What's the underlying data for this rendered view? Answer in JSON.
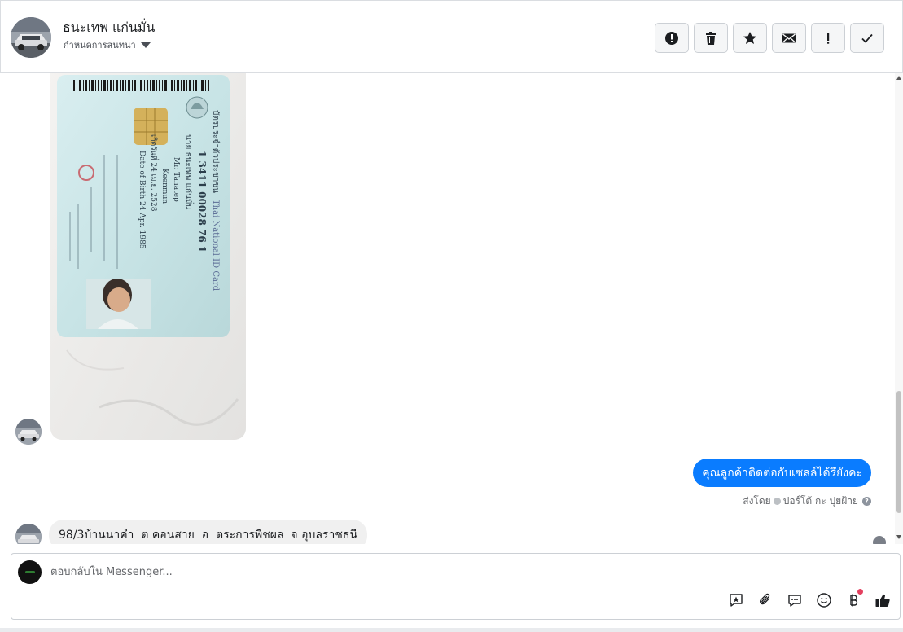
{
  "header": {
    "contact_name": "ธนะเทพ แก่นมั่น",
    "assign_label": "กำหนดการสนทนา",
    "toolbar": [
      {
        "name": "mark-spam-button",
        "icon": "alert-circle-icon"
      },
      {
        "name": "delete-button",
        "icon": "trash-icon"
      },
      {
        "name": "star-button",
        "icon": "star-icon"
      },
      {
        "name": "mark-unread-button",
        "icon": "envelope-icon"
      },
      {
        "name": "follow-up-button",
        "icon": "exclamation-icon"
      },
      {
        "name": "mark-done-button",
        "icon": "checkmark-icon"
      }
    ]
  },
  "thread": {
    "id_card": {
      "title_th": "บัตรประจำตัวประชาชน",
      "title_en": "Thai National ID Card",
      "id_number": "1 3411 00028 76 1",
      "name_th": "นาย ธนะเทพ แก่นมั่น",
      "name_en_label": "Name",
      "name_en": "Mr. Tanatep",
      "last_name_label": "Last name",
      "last_name": "Keenmun",
      "dob_th": "เกิดวันที่ 24 เม.ย. 2528",
      "dob_en": "Date of Birth 24 Apr. 1985"
    },
    "outgoing_message": "คุณลูกค้าติดต่อกับเซลล์ได้รึยังคะ",
    "sent_by_prefix": "ส่งโดย",
    "sent_by_name": "ปอร์โต้ กะ ปุยฝ้าย",
    "incoming_message": "98/3บ้านนาคำ  ต คอนสาย  อ  ตระการพืชผล  จ อุบลราชธนี"
  },
  "composer": {
    "placeholder": "ตอบกลับใน Messenger...",
    "tools": [
      "saved-reply-icon",
      "attachment-icon",
      "chat-bubble-icon",
      "emoji-icon",
      "baht-payment-icon",
      "thumbs-up-icon"
    ]
  },
  "colors": {
    "accent": "#0a7cff",
    "incoming_bubble": "#f0f0f0",
    "notification_dot": "#e4405f"
  }
}
